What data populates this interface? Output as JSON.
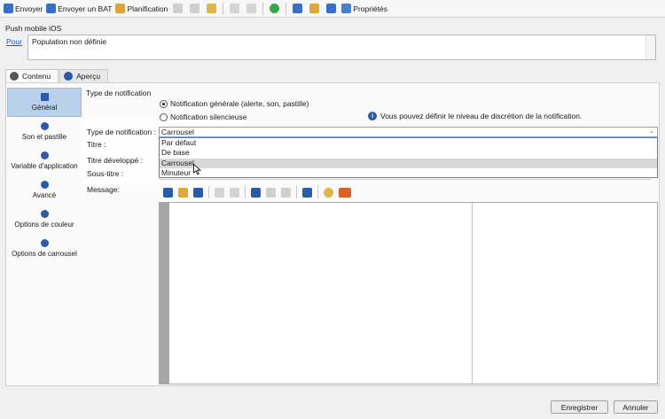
{
  "toolbar": {
    "send": "Envoyer",
    "send_proof": "Envoyer un BAT",
    "schedule": "Planification",
    "properties": "Propriétés"
  },
  "header": {
    "section_title": "Push mobile iOS",
    "to_link": "Pour",
    "population": "Population non définie"
  },
  "tabs": [
    {
      "label": "Contenu"
    },
    {
      "label": "Aperçu"
    }
  ],
  "nav": [
    {
      "label": "Général"
    },
    {
      "label": "Son et pastille"
    },
    {
      "label": "Variable d'application"
    },
    {
      "label": "Avancé"
    },
    {
      "label": "Options de couleur"
    },
    {
      "label": "Options de carrousel"
    }
  ],
  "content": {
    "notif_type_heading": "Type de notification",
    "radio_general": "Notification générale (alerte, son, pastille)",
    "radio_silent": "Notification silencieuse",
    "info_text": "Vous pouvez définir le niveau de discrétion de la notification.",
    "type_label": "Type de notification :",
    "title_label": "Titre :",
    "expanded_title_label": "Titre développé :",
    "subtitle_label": "Sous-titre :",
    "message_label": "Message:",
    "selected_type": "Carrousel",
    "options": [
      "Par défaut",
      "De base",
      "Carrousel",
      "Minuteur"
    ]
  },
  "footer": {
    "save": "Enregistrer",
    "cancel": "Annuler"
  },
  "colors": {
    "accent_blue": "#2b5aa8",
    "nav_active": "#b9d1ea"
  }
}
